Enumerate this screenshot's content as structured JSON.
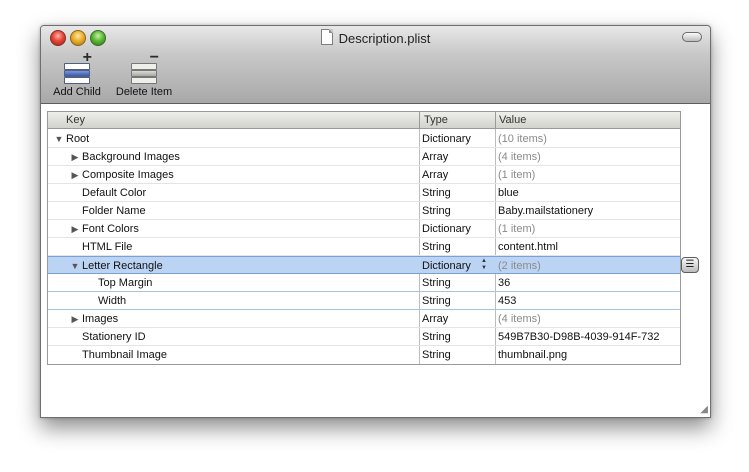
{
  "window": {
    "title": "Description.plist",
    "icon": "document-icon"
  },
  "toolbar": {
    "add_child_label": "Add Child",
    "delete_item_label": "Delete Item"
  },
  "outline": {
    "columns": {
      "key": "Key",
      "type": "Type",
      "value": "Value"
    },
    "rows": [
      {
        "key": "Root",
        "type": "Dictionary",
        "value": "(10 items)"
      },
      {
        "key": "Background Images",
        "type": "Array",
        "value": "(4 items)"
      },
      {
        "key": "Composite Images",
        "type": "Array",
        "value": "(1 item)"
      },
      {
        "key": "Default Color",
        "type": "String",
        "value": "blue"
      },
      {
        "key": "Folder Name",
        "type": "String",
        "value": "Baby.mailstationery"
      },
      {
        "key": "Font Colors",
        "type": "Dictionary",
        "value": "(1 item)"
      },
      {
        "key": "HTML File",
        "type": "String",
        "value": "content.html"
      },
      {
        "key": "Letter Rectangle",
        "type": "Dictionary",
        "value": "(2 items)"
      },
      {
        "key": "Top Margin",
        "type": "String",
        "value": "36"
      },
      {
        "key": "Width",
        "type": "String",
        "value": "453"
      },
      {
        "key": "Images",
        "type": "Array",
        "value": "(4 items)"
      },
      {
        "key": "Stationery ID",
        "type": "String",
        "value": "549B7B30-D98B-4039-914F-732"
      },
      {
        "key": "Thumbnail Image",
        "type": "String",
        "value": "thumbnail.png"
      }
    ]
  },
  "colors": {
    "selection": "#bcd4f4",
    "selection_border": "#7aa0d6",
    "summary_text": "#8a8a8a"
  }
}
